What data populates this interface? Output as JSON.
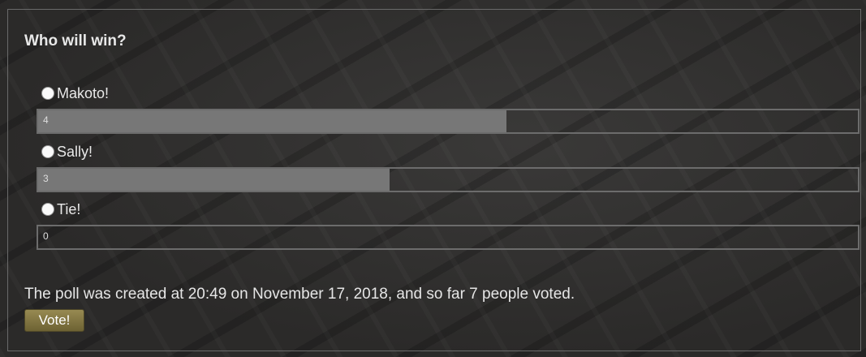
{
  "poll": {
    "question": "Who will win?",
    "options": [
      {
        "label": "Makoto!",
        "votes": "4",
        "fraction": 0.5714
      },
      {
        "label": "Sally!",
        "votes": "3",
        "fraction": 0.4286
      },
      {
        "label": "Tie!",
        "votes": "0",
        "fraction": 0
      }
    ],
    "summary": "The poll was created at 20:49 on November 17, 2018, and so far 7 people voted.",
    "vote_label": "Vote!"
  },
  "colors": {
    "bar_fill": "#777777",
    "button": "#8a7e48"
  }
}
